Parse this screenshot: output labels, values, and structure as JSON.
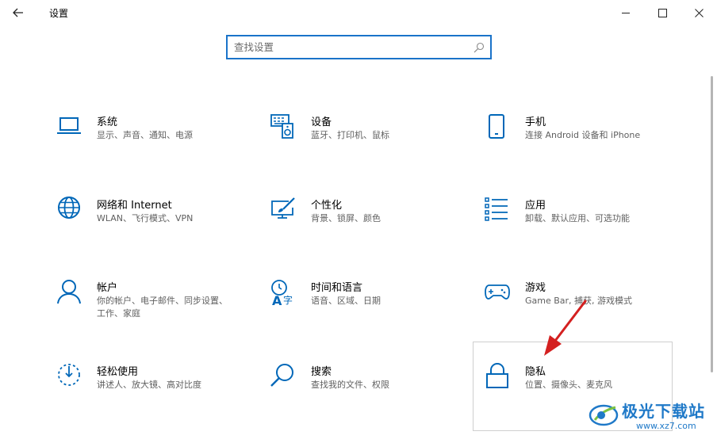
{
  "window": {
    "title": "设置"
  },
  "search": {
    "placeholder": "查找设置"
  },
  "tiles": [
    {
      "title": "系统",
      "desc": "显示、声音、通知、电源",
      "icon": "laptop-icon"
    },
    {
      "title": "设备",
      "desc": "蓝牙、打印机、鼠标",
      "icon": "keyboard-speaker-icon"
    },
    {
      "title": "手机",
      "desc": "连接 Android 设备和 iPhone",
      "icon": "phone-icon"
    },
    {
      "title": "网络和 Internet",
      "desc": "WLAN、飞行模式、VPN",
      "icon": "globe-icon"
    },
    {
      "title": "个性化",
      "desc": "背景、锁屏、颜色",
      "icon": "paint-monitor-icon"
    },
    {
      "title": "应用",
      "desc": "卸载、默认应用、可选功能",
      "icon": "apps-list-icon"
    },
    {
      "title": "帐户",
      "desc": "你的帐户、电子邮件、同步设置、工作、家庭",
      "icon": "person-icon"
    },
    {
      "title": "时间和语言",
      "desc": "语音、区域、日期",
      "icon": "time-language-icon"
    },
    {
      "title": "游戏",
      "desc": "Game Bar, 捕获, 游戏模式",
      "icon": "gamepad-icon"
    },
    {
      "title": "轻松使用",
      "desc": "讲述人、放大镜、高对比度",
      "icon": "ease-of-access-icon"
    },
    {
      "title": "搜索",
      "desc": "查找我的文件、权限",
      "icon": "magnifier-icon"
    },
    {
      "title": "隐私",
      "desc": "位置、摄像头、麦克风",
      "icon": "lock-icon"
    }
  ],
  "watermark": {
    "name": "极光下载站",
    "url": "www.xz7.com"
  },
  "colors": {
    "accent": "#0067b8",
    "annotation_arrow": "#d42020"
  }
}
